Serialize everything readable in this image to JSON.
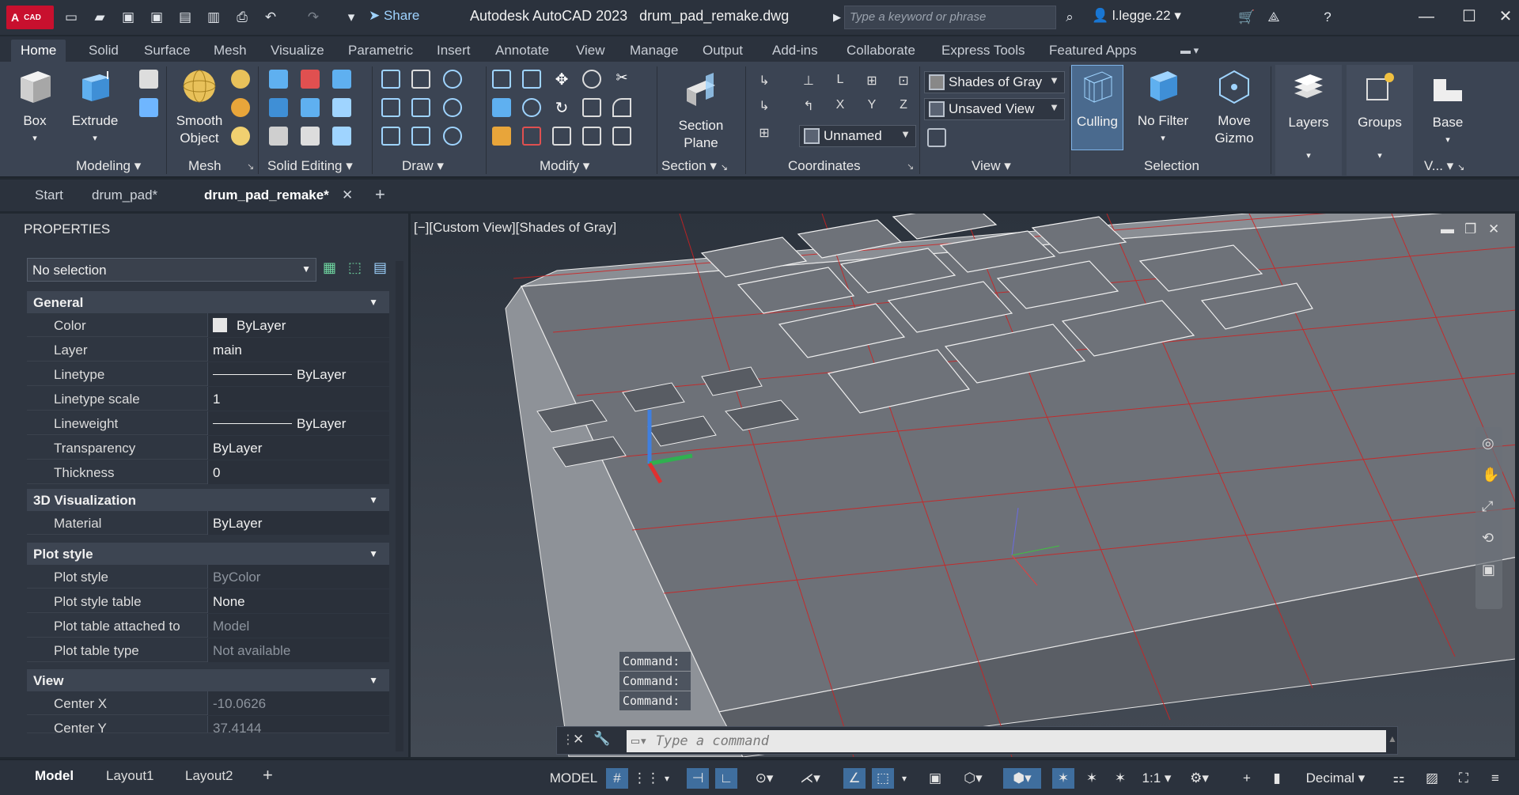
{
  "app": {
    "logo_text": "A",
    "logo_sub": "CAD",
    "share": "Share",
    "title_app": "Autodesk AutoCAD 2023",
    "title_file": "drum_pad_remake.dwg",
    "search_placeholder": "Type a keyword or phrase",
    "user": "l.legge.22"
  },
  "ribbon_tabs": [
    "Home",
    "Solid",
    "Surface",
    "Mesh",
    "Visualize",
    "Parametric",
    "Insert",
    "Annotate",
    "View",
    "Manage",
    "Output",
    "Add-ins",
    "Collaborate",
    "Express Tools",
    "Featured Apps"
  ],
  "ribbon": {
    "box": "Box",
    "extrude": "Extrude",
    "smooth_object_1": "Smooth",
    "smooth_object_2": "Object",
    "section_plane_1": "Section",
    "section_plane_2": "Plane",
    "visual_style": "Shades of Gray",
    "saved_view": "Unsaved View",
    "ucs_name": "Unnamed",
    "culling": "Culling",
    "no_filter": "No Filter",
    "move_gizmo_1": "Move",
    "move_gizmo_2": "Gizmo",
    "layers": "Layers",
    "groups": "Groups",
    "base": "Base",
    "panels": {
      "modeling": "Modeling",
      "mesh": "Mesh",
      "solid_editing": "Solid Editing",
      "draw": "Draw",
      "modify": "Modify",
      "section": "Section",
      "coordinates": "Coordinates",
      "view": "View",
      "selection": "Selection",
      "v_short": "V..."
    }
  },
  "doc_tabs": [
    "Start",
    "drum_pad*",
    "drum_pad_remake*"
  ],
  "properties": {
    "title": "PROPERTIES",
    "selection": "No selection",
    "general": "General",
    "color_label": "Color",
    "color_value": "ByLayer",
    "layer_label": "Layer",
    "layer_value": "main",
    "linetype_label": "Linetype",
    "linetype_value": "ByLayer",
    "ltscale_label": "Linetype scale",
    "ltscale_value": "1",
    "lineweight_label": "Lineweight",
    "lineweight_value": "ByLayer",
    "transparency_label": "Transparency",
    "transparency_value": "ByLayer",
    "thickness_label": "Thickness",
    "thickness_value": "0",
    "viz": "3D Visualization",
    "material_label": "Material",
    "material_value": "ByLayer",
    "plot": "Plot style",
    "plotstyle_label": "Plot style",
    "plotstyle_value": "ByColor",
    "plottable_label": "Plot style table",
    "plottable_value": "None",
    "plotattached_label": "Plot table attached to",
    "plotattached_value": "Model",
    "plottype_label": "Plot table type",
    "plottype_value": "Not available",
    "view": "View",
    "centerx_label": "Center X",
    "centerx_value": "-10.0626",
    "centery_label": "Center Y",
    "centery_value": "37.4144"
  },
  "viewport": {
    "label": "[−][Custom View][Shades of Gray]",
    "command_history": [
      "Command:",
      "Command:",
      "Command:"
    ],
    "command_placeholder": "Type a command"
  },
  "status": {
    "model_tab": "Model",
    "layout1": "Layout1",
    "layout2": "Layout2",
    "model_button": "MODEL",
    "scale": "1:1",
    "units": "Decimal"
  }
}
